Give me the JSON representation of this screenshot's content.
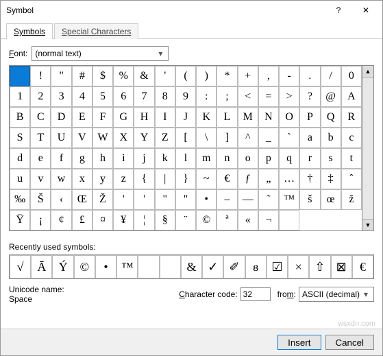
{
  "window": {
    "title": "Symbol",
    "help": "?",
    "close": "✕"
  },
  "tabs": [
    {
      "label": "Symbols",
      "active": true
    },
    {
      "label": "Special Characters",
      "active": false
    }
  ],
  "font": {
    "label": "Font:",
    "value": "(normal text)"
  },
  "grid_selected": 0,
  "grid": [
    " ",
    "!",
    "\"",
    "#",
    "$",
    "%",
    "&",
    "'",
    "(",
    ")",
    "*",
    "+",
    ",",
    "-",
    ".",
    "/",
    "0",
    "1",
    "2",
    "3",
    "4",
    "5",
    "6",
    "7",
    "8",
    "9",
    ":",
    ";",
    "<",
    "=",
    ">",
    "?",
    "@",
    "A",
    "B",
    "C",
    "D",
    "E",
    "F",
    "G",
    "H",
    "I",
    "J",
    "K",
    "L",
    "M",
    "N",
    "O",
    "P",
    "Q",
    "R",
    "S",
    "T",
    "U",
    "V",
    "W",
    "X",
    "Y",
    "Z",
    "[",
    "\\",
    "]",
    "^",
    "_",
    "`",
    "a",
    "b",
    "c",
    "d",
    "e",
    "f",
    "g",
    "h",
    "i",
    "j",
    "k",
    "l",
    "m",
    "n",
    "o",
    "p",
    "q",
    "r",
    "s",
    "t",
    "u",
    "v",
    "w",
    "x",
    "y",
    "z",
    "{",
    "|",
    "}",
    "~",
    "€",
    "ƒ",
    "„",
    "…",
    "†",
    "‡",
    "ˆ",
    "‰",
    "Š",
    "‹",
    "Œ",
    "Ž",
    "'",
    "'",
    "\"",
    "\"",
    "•",
    "–",
    "—",
    "˜",
    "™",
    "š",
    "œ",
    "ž",
    "Ÿ",
    "¡",
    "¢",
    "£",
    "¤",
    "¥",
    "¦",
    "§",
    "¨",
    "©",
    "ª",
    "«",
    "¬",
    "­"
  ],
  "recent_label": "Recently used symbols:",
  "recent": [
    "√",
    "Ā",
    "Ý",
    "©",
    "•",
    "™",
    "",
    "",
    "&",
    "✓",
    "✐",
    "ᴕ",
    "☑",
    "×",
    "⇧",
    "⊠",
    "€"
  ],
  "unicode": {
    "label": "Unicode name:",
    "value": "Space"
  },
  "code": {
    "label": "Character code:",
    "value": "32"
  },
  "from": {
    "label": "from:",
    "value": "ASCII (decimal)"
  },
  "buttons": {
    "insert": "Insert",
    "cancel": "Cancel"
  },
  "watermark": "wsxdn.com"
}
